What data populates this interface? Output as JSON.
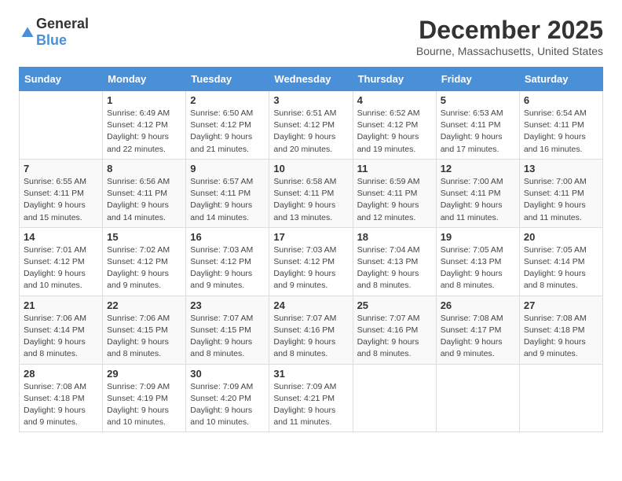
{
  "logo": {
    "text_general": "General",
    "text_blue": "Blue"
  },
  "title": {
    "month": "December 2025",
    "location": "Bourne, Massachusetts, United States"
  },
  "weekdays": [
    "Sunday",
    "Monday",
    "Tuesday",
    "Wednesday",
    "Thursday",
    "Friday",
    "Saturday"
  ],
  "weeks": [
    [
      {
        "day": "",
        "info": ""
      },
      {
        "day": "1",
        "info": "Sunrise: 6:49 AM\nSunset: 4:12 PM\nDaylight: 9 hours\nand 22 minutes."
      },
      {
        "day": "2",
        "info": "Sunrise: 6:50 AM\nSunset: 4:12 PM\nDaylight: 9 hours\nand 21 minutes."
      },
      {
        "day": "3",
        "info": "Sunrise: 6:51 AM\nSunset: 4:12 PM\nDaylight: 9 hours\nand 20 minutes."
      },
      {
        "day": "4",
        "info": "Sunrise: 6:52 AM\nSunset: 4:12 PM\nDaylight: 9 hours\nand 19 minutes."
      },
      {
        "day": "5",
        "info": "Sunrise: 6:53 AM\nSunset: 4:11 PM\nDaylight: 9 hours\nand 17 minutes."
      },
      {
        "day": "6",
        "info": "Sunrise: 6:54 AM\nSunset: 4:11 PM\nDaylight: 9 hours\nand 16 minutes."
      }
    ],
    [
      {
        "day": "7",
        "info": "Sunrise: 6:55 AM\nSunset: 4:11 PM\nDaylight: 9 hours\nand 15 minutes."
      },
      {
        "day": "8",
        "info": "Sunrise: 6:56 AM\nSunset: 4:11 PM\nDaylight: 9 hours\nand 14 minutes."
      },
      {
        "day": "9",
        "info": "Sunrise: 6:57 AM\nSunset: 4:11 PM\nDaylight: 9 hours\nand 14 minutes."
      },
      {
        "day": "10",
        "info": "Sunrise: 6:58 AM\nSunset: 4:11 PM\nDaylight: 9 hours\nand 13 minutes."
      },
      {
        "day": "11",
        "info": "Sunrise: 6:59 AM\nSunset: 4:11 PM\nDaylight: 9 hours\nand 12 minutes."
      },
      {
        "day": "12",
        "info": "Sunrise: 7:00 AM\nSunset: 4:11 PM\nDaylight: 9 hours\nand 11 minutes."
      },
      {
        "day": "13",
        "info": "Sunrise: 7:00 AM\nSunset: 4:11 PM\nDaylight: 9 hours\nand 11 minutes."
      }
    ],
    [
      {
        "day": "14",
        "info": "Sunrise: 7:01 AM\nSunset: 4:12 PM\nDaylight: 9 hours\nand 10 minutes."
      },
      {
        "day": "15",
        "info": "Sunrise: 7:02 AM\nSunset: 4:12 PM\nDaylight: 9 hours\nand 9 minutes."
      },
      {
        "day": "16",
        "info": "Sunrise: 7:03 AM\nSunset: 4:12 PM\nDaylight: 9 hours\nand 9 minutes."
      },
      {
        "day": "17",
        "info": "Sunrise: 7:03 AM\nSunset: 4:12 PM\nDaylight: 9 hours\nand 9 minutes."
      },
      {
        "day": "18",
        "info": "Sunrise: 7:04 AM\nSunset: 4:13 PM\nDaylight: 9 hours\nand 8 minutes."
      },
      {
        "day": "19",
        "info": "Sunrise: 7:05 AM\nSunset: 4:13 PM\nDaylight: 9 hours\nand 8 minutes."
      },
      {
        "day": "20",
        "info": "Sunrise: 7:05 AM\nSunset: 4:14 PM\nDaylight: 9 hours\nand 8 minutes."
      }
    ],
    [
      {
        "day": "21",
        "info": "Sunrise: 7:06 AM\nSunset: 4:14 PM\nDaylight: 9 hours\nand 8 minutes."
      },
      {
        "day": "22",
        "info": "Sunrise: 7:06 AM\nSunset: 4:15 PM\nDaylight: 9 hours\nand 8 minutes."
      },
      {
        "day": "23",
        "info": "Sunrise: 7:07 AM\nSunset: 4:15 PM\nDaylight: 9 hours\nand 8 minutes."
      },
      {
        "day": "24",
        "info": "Sunrise: 7:07 AM\nSunset: 4:16 PM\nDaylight: 9 hours\nand 8 minutes."
      },
      {
        "day": "25",
        "info": "Sunrise: 7:07 AM\nSunset: 4:16 PM\nDaylight: 9 hours\nand 8 minutes."
      },
      {
        "day": "26",
        "info": "Sunrise: 7:08 AM\nSunset: 4:17 PM\nDaylight: 9 hours\nand 9 minutes."
      },
      {
        "day": "27",
        "info": "Sunrise: 7:08 AM\nSunset: 4:18 PM\nDaylight: 9 hours\nand 9 minutes."
      }
    ],
    [
      {
        "day": "28",
        "info": "Sunrise: 7:08 AM\nSunset: 4:18 PM\nDaylight: 9 hours\nand 9 minutes."
      },
      {
        "day": "29",
        "info": "Sunrise: 7:09 AM\nSunset: 4:19 PM\nDaylight: 9 hours\nand 10 minutes."
      },
      {
        "day": "30",
        "info": "Sunrise: 7:09 AM\nSunset: 4:20 PM\nDaylight: 9 hours\nand 10 minutes."
      },
      {
        "day": "31",
        "info": "Sunrise: 7:09 AM\nSunset: 4:21 PM\nDaylight: 9 hours\nand 11 minutes."
      },
      {
        "day": "",
        "info": ""
      },
      {
        "day": "",
        "info": ""
      },
      {
        "day": "",
        "info": ""
      }
    ]
  ]
}
